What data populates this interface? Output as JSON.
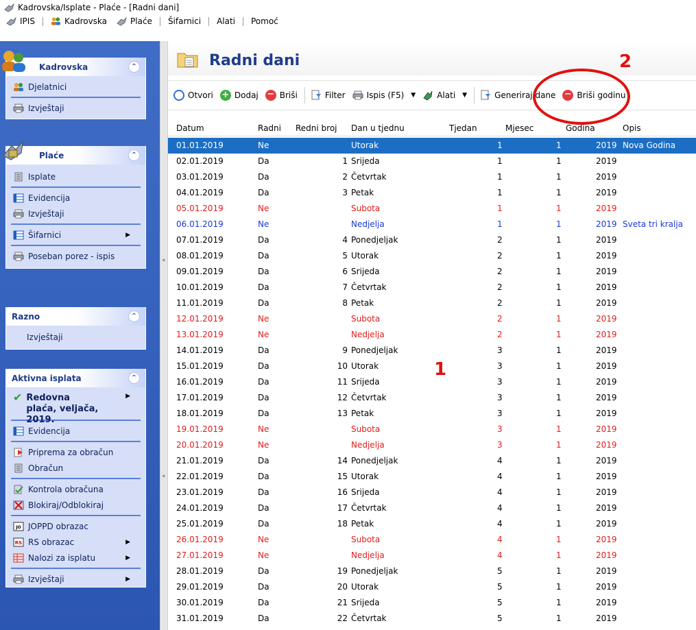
{
  "window": {
    "title": "Kadrovska/Isplate - Plaće - [Radni dani]"
  },
  "menu": [
    "IPIS",
    "Kadrovska",
    "Plaće",
    "Šifarnici",
    "Alati",
    "Pomoć"
  ],
  "sidebar": {
    "kadrovska": {
      "title": "Kadrovska",
      "items": [
        "Djelatnici",
        "Izvještaji"
      ]
    },
    "place": {
      "title": "Plaće",
      "items": [
        "Isplate",
        "Evidencija",
        "Izvještaji",
        "Šifarnici",
        "Poseban porez - ispis"
      ]
    },
    "razno": {
      "title": "Razno",
      "items": [
        "Izvještaji"
      ]
    },
    "aktivna": {
      "title": "Aktivna isplata",
      "current": "Redovna plaća, veljača, 2019.",
      "items": [
        "Evidencija",
        "Priprema za obračun",
        "Obračun",
        "Kontrola obračuna",
        "Blokiraj/Odblokiraj",
        "JOPPD obrazac",
        "RS obrazac",
        "Nalozi za isplatu",
        "Izvještaji"
      ]
    }
  },
  "page": {
    "title": "Radni dani"
  },
  "toolbar": {
    "otvori": "Otvori",
    "dodaj": "Dodaj",
    "brisi": "Briši",
    "filter": "Filter",
    "ispis": "Ispis (F5)",
    "alati": "Alati",
    "generiraj": "Generiraj dane",
    "brisi_godinu": "Briši godinu"
  },
  "annotations": {
    "one": "1",
    "two": "2"
  },
  "columns": [
    "Datum",
    "Radni",
    "Redni broj",
    "Dan u tjednu",
    "Tjedan",
    "Mjesec",
    "Godina",
    "Opis"
  ],
  "rows": [
    [
      "01.01.2019",
      "Ne",
      "",
      "Utorak",
      "1",
      "1",
      "2019",
      "Nova Godina",
      "sel"
    ],
    [
      "02.01.2019",
      "Da",
      "1",
      "Srijeda",
      "1",
      "1",
      "2019",
      "",
      ""
    ],
    [
      "03.01.2019",
      "Da",
      "2",
      "Četvrtak",
      "1",
      "1",
      "2019",
      "",
      ""
    ],
    [
      "04.01.2019",
      "Da",
      "3",
      "Petak",
      "1",
      "1",
      "2019",
      "",
      ""
    ],
    [
      "05.01.2019",
      "Ne",
      "",
      "Subota",
      "1",
      "1",
      "2019",
      "",
      "red"
    ],
    [
      "06.01.2019",
      "Ne",
      "",
      "Nedjelja",
      "1",
      "1",
      "2019",
      "Sveta tri kralja",
      "blue"
    ],
    [
      "07.01.2019",
      "Da",
      "4",
      "Ponedjeljak",
      "2",
      "1",
      "2019",
      "",
      ""
    ],
    [
      "08.01.2019",
      "Da",
      "5",
      "Utorak",
      "2",
      "1",
      "2019",
      "",
      ""
    ],
    [
      "09.01.2019",
      "Da",
      "6",
      "Srijeda",
      "2",
      "1",
      "2019",
      "",
      ""
    ],
    [
      "10.01.2019",
      "Da",
      "7",
      "Četvrtak",
      "2",
      "1",
      "2019",
      "",
      ""
    ],
    [
      "11.01.2019",
      "Da",
      "8",
      "Petak",
      "2",
      "1",
      "2019",
      "",
      ""
    ],
    [
      "12.01.2019",
      "Ne",
      "",
      "Subota",
      "2",
      "1",
      "2019",
      "",
      "red"
    ],
    [
      "13.01.2019",
      "Ne",
      "",
      "Nedjelja",
      "2",
      "1",
      "2019",
      "",
      "red"
    ],
    [
      "14.01.2019",
      "Da",
      "9",
      "Ponedjeljak",
      "3",
      "1",
      "2019",
      "",
      ""
    ],
    [
      "15.01.2019",
      "Da",
      "10",
      "Utorak",
      "3",
      "1",
      "2019",
      "",
      ""
    ],
    [
      "16.01.2019",
      "Da",
      "11",
      "Srijeda",
      "3",
      "1",
      "2019",
      "",
      ""
    ],
    [
      "17.01.2019",
      "Da",
      "12",
      "Četvrtak",
      "3",
      "1",
      "2019",
      "",
      ""
    ],
    [
      "18.01.2019",
      "Da",
      "13",
      "Petak",
      "3",
      "1",
      "2019",
      "",
      ""
    ],
    [
      "19.01.2019",
      "Ne",
      "",
      "Subota",
      "3",
      "1",
      "2019",
      "",
      "red"
    ],
    [
      "20.01.2019",
      "Ne",
      "",
      "Nedjelja",
      "3",
      "1",
      "2019",
      "",
      "red"
    ],
    [
      "21.01.2019",
      "Da",
      "14",
      "Ponedjeljak",
      "4",
      "1",
      "2019",
      "",
      ""
    ],
    [
      "22.01.2019",
      "Da",
      "15",
      "Utorak",
      "4",
      "1",
      "2019",
      "",
      ""
    ],
    [
      "23.01.2019",
      "Da",
      "16",
      "Srijeda",
      "4",
      "1",
      "2019",
      "",
      ""
    ],
    [
      "24.01.2019",
      "Da",
      "17",
      "Četvrtak",
      "4",
      "1",
      "2019",
      "",
      ""
    ],
    [
      "25.01.2019",
      "Da",
      "18",
      "Petak",
      "4",
      "1",
      "2019",
      "",
      ""
    ],
    [
      "26.01.2019",
      "Ne",
      "",
      "Subota",
      "4",
      "1",
      "2019",
      "",
      "red"
    ],
    [
      "27.01.2019",
      "Ne",
      "",
      "Nedjelja",
      "4",
      "1",
      "2019",
      "",
      "red"
    ],
    [
      "28.01.2019",
      "Da",
      "19",
      "Ponedjeljak",
      "5",
      "1",
      "2019",
      "",
      ""
    ],
    [
      "29.01.2019",
      "Da",
      "20",
      "Utorak",
      "5",
      "1",
      "2019",
      "",
      ""
    ],
    [
      "30.01.2019",
      "Da",
      "21",
      "Srijeda",
      "5",
      "1",
      "2019",
      "",
      ""
    ],
    [
      "31.01.2019",
      "Da",
      "22",
      "Četvrtak",
      "5",
      "1",
      "2019",
      "",
      ""
    ]
  ]
}
